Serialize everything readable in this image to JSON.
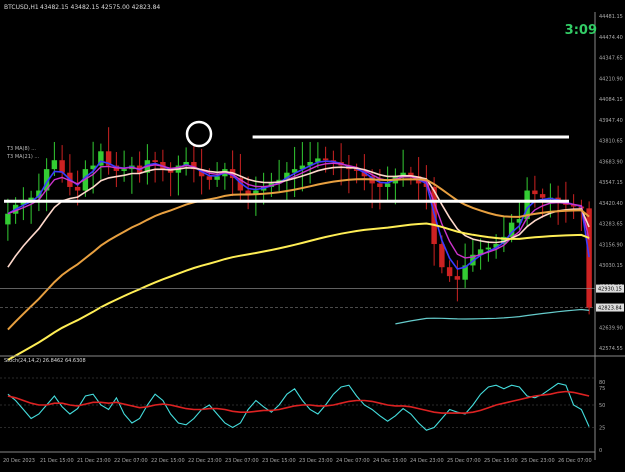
{
  "symbol_label": "BTCUSD,H1",
  "header_values": "43482.15 43482.15 42575.00 42823.84",
  "timer": "3:09",
  "ma_label_1": "T3 MA(8) ...",
  "ma_label_2": "T3 MA(21) ...",
  "colors": {
    "background": "#000000",
    "bull": "#33cc33",
    "bear": "#cc2222",
    "ema_fast": "#3b3bff",
    "ema_mid": "#cc33cc",
    "ema_slow": "#ffd9cc",
    "ema_orange": "#e8a040",
    "ema_yellow": "#ffee55",
    "ema_cyan": "#66cccc",
    "stoch_main": "#44dddd",
    "stoch_signal": "#dd2222",
    "timer": "#33cc66",
    "axis_text": "#aaaaaa",
    "levels": "#ffffff"
  },
  "chart_data": [
    {
      "type": "candlestick",
      "title": "BTCUSD,H1",
      "ylim": [
        42574.55,
        44481.15
      ],
      "y_ticks": [
        "44481.15",
        "44474.40",
        "44347.65",
        "44210.90",
        "44084.15",
        "43947.40",
        "43810.65",
        "43683.90",
        "43547.15",
        "43420.40",
        "43283.65",
        "43156.90",
        "43030.15",
        "42893.40",
        "42766.65",
        "42639.90",
        "42574.55"
      ],
      "x_ticks": [
        "20 Dec 2023",
        "21 Dec 15:00",
        "21 Dec 23:00",
        "22 Dec 07:00",
        "22 Dec 15:00",
        "22 Dec 23:00",
        "23 Dec 07:00",
        "23 Dec 15:00",
        "23 Dec 23:00",
        "24 Dec 07:00",
        "24 Dec 15:00",
        "24 Dec 23:00",
        "25 Dec 07:00",
        "25 Dec 15:00",
        "25 Dec 23:00",
        "26 Dec 07:00"
      ],
      "price_markers": [
        {
          "label": "42930.15",
          "value": 42930.15
        },
        {
          "label": "42823.84",
          "value": 42823.84
        }
      ],
      "horizontal_levels": [
        {
          "value": 43780,
          "from_index": 0.44,
          "to_index": 1.0
        },
        {
          "value": 43420,
          "from_index": 0.0,
          "to_index": 1.0
        }
      ],
      "closes": [
        43350,
        43400,
        43420,
        43440,
        43480,
        43600,
        43650,
        43580,
        43500,
        43480,
        43600,
        43620,
        43700,
        43620,
        43590,
        43600,
        43620,
        43580,
        43650,
        43640,
        43600,
        43580,
        43620,
        43640,
        43600,
        43560,
        43540,
        43560,
        43600,
        43550,
        43480,
        43460,
        43480,
        43500,
        43520,
        43540,
        43580,
        43600,
        43620,
        43640,
        43660,
        43650,
        43640,
        43620,
        43600,
        43590,
        43560,
        43520,
        43500,
        43520,
        43560,
        43580,
        43560,
        43520,
        43500,
        43180,
        43050,
        43000,
        42980,
        43060,
        43120,
        43150,
        43160,
        43180,
        43220,
        43300,
        43320,
        43480,
        43460,
        43440,
        43440,
        43420,
        43400,
        43390,
        43380,
        42823
      ]
    },
    {
      "type": "line",
      "title": "Stoch(24,14,2) 26.8462 64.6308",
      "ylim": [
        0,
        100
      ],
      "y_ticks": [
        "80",
        "75",
        "50",
        "25",
        "0"
      ],
      "series": [
        {
          "values": [
            62,
            55,
            45,
            35,
            40,
            50,
            60,
            48,
            40,
            46,
            60,
            62,
            50,
            45,
            58,
            40,
            30,
            35,
            50,
            62,
            55,
            40,
            30,
            28,
            35,
            45,
            50,
            40,
            30,
            25,
            30,
            45,
            55,
            48,
            42,
            50,
            62,
            68,
            55,
            45,
            40,
            50,
            62,
            70,
            72,
            60,
            50,
            45,
            38,
            32,
            38,
            46,
            40,
            30,
            22,
            25,
            35,
            45,
            42,
            40,
            50,
            62,
            70,
            72,
            68,
            72,
            70,
            60,
            58,
            62,
            68,
            74,
            72,
            50,
            45,
            26
          ]
        },
        {
          "values": [
            60,
            58,
            55,
            52,
            50,
            50,
            52,
            52,
            50,
            49,
            51,
            53,
            53,
            52,
            53,
            51,
            49,
            47,
            48,
            50,
            51,
            50,
            48,
            46,
            45,
            45,
            46,
            46,
            45,
            43,
            42,
            42,
            43,
            44,
            44,
            45,
            47,
            49,
            50,
            50,
            49,
            49,
            50,
            52,
            54,
            55,
            55,
            54,
            52,
            50,
            49,
            49,
            48,
            46,
            44,
            42,
            41,
            41,
            41,
            41,
            42,
            44,
            47,
            50,
            52,
            54,
            56,
            58,
            60,
            61,
            62,
            64,
            65,
            64,
            62,
            60
          ]
        }
      ]
    }
  ]
}
